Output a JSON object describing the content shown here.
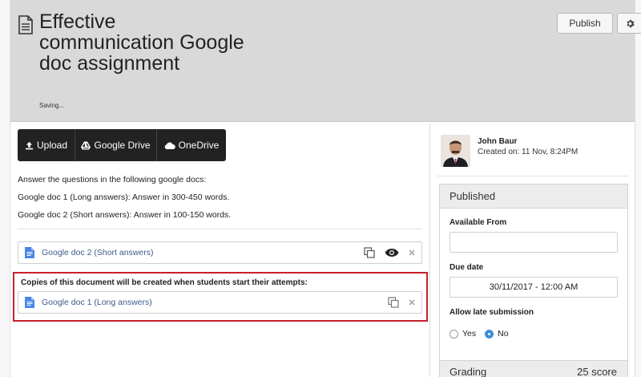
{
  "header": {
    "title": "Effective communication Google doc assignment",
    "status": "Saving...",
    "publish_label": "Publish"
  },
  "uploads": [
    {
      "label": "Upload",
      "icon": "upload-icon"
    },
    {
      "label": "Google Drive",
      "icon": "google-drive-icon"
    },
    {
      "label": "OneDrive",
      "icon": "onedrive-icon"
    }
  ],
  "instructions": [
    "Answer the questions in the following google docs:",
    "Google doc 1 (Long answers): Answer in 300-450 words.",
    "Google doc 2 (Short answers): Answer in 100-150 words."
  ],
  "docs": {
    "shared": {
      "name": "Google doc 2 (Short answers)"
    },
    "copies_label": "Copies of this document will be created when students start their attempts:",
    "copy": {
      "name": "Google doc 1 (Long answers)"
    }
  },
  "author": {
    "name": "John Baur",
    "created": "Created on: 11 Nov, 8:24PM"
  },
  "publish_panel": {
    "title": "Published",
    "available_from_label": "Available From",
    "available_from_value": "",
    "due_date_label": "Due date",
    "due_date_value": "30/11/2017 - 12:00 AM",
    "late_label": "Allow late submission",
    "yes_label": "Yes",
    "no_label": "No",
    "late_selected": "No"
  },
  "grading": {
    "label": "Grading",
    "score": "25 score"
  },
  "colors": {
    "highlight_border": "#c8202f",
    "doc_link": "#3d5a8a",
    "radio_selected": "#3c8fd8",
    "google_doc_blue": "#4a86e8"
  }
}
